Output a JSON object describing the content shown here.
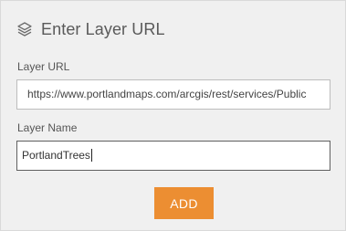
{
  "header": {
    "title": "Enter Layer URL",
    "icon": "layers-icon"
  },
  "form": {
    "url_label": "Layer URL",
    "url_value": "https://www.portlandmaps.com/arcgis/rest/services/Public",
    "name_label": "Layer Name",
    "name_value": "PortlandTrees",
    "add_label": "ADD"
  },
  "colors": {
    "panel_bg": "#f0f0f0",
    "accent_button": "#ec8e32",
    "title_text": "#5a5a5a"
  }
}
